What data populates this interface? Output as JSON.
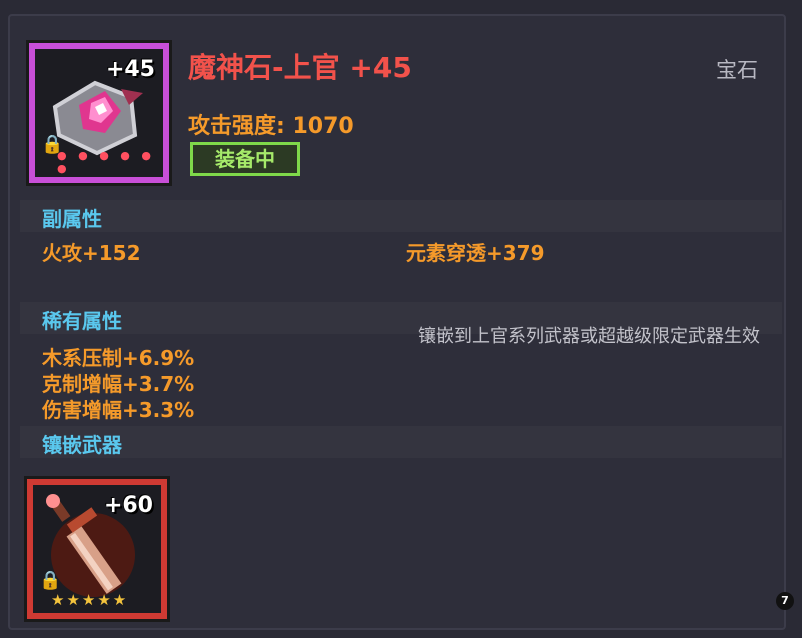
{
  "item": {
    "name": "魔神石-上官 +45",
    "type": "宝石",
    "icon_level": "+45",
    "attack_label": "攻击强度: 1070",
    "status_badge": "装备中",
    "lock_icon": "lock-icon",
    "slot_dots": "● ● ● ● ● ●"
  },
  "sub_attributes": {
    "title": "副属性",
    "stats": [
      "火攻+152",
      "元素穿透+379"
    ]
  },
  "rare_attributes": {
    "title": "稀有属性",
    "note": "镶嵌到上官系列武器或超越级限定武器生效",
    "stats": [
      "木系压制+6.9%",
      "克制增幅+3.7%",
      "伤害增幅+3.3%"
    ]
  },
  "inlay_weapon": {
    "title": "镶嵌武器",
    "weapon_level": "+60",
    "stars": "★★★★★",
    "lock_icon": "lock-icon"
  },
  "page_badge": "7",
  "colors": {
    "title_red": "#f2524b",
    "stat_orange": "#f59a2a",
    "section_cyan": "#5ac8ee",
    "equipped_green": "#7fd94a",
    "gem_frame_purple": "#c84fd8",
    "weapon_frame_red": "#cf3a33"
  }
}
